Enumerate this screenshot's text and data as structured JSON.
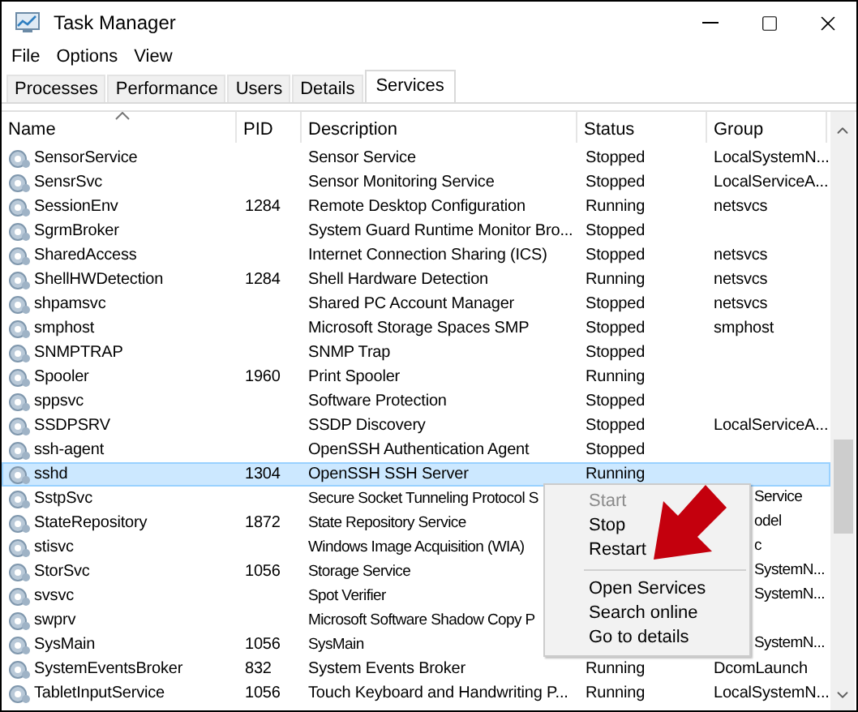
{
  "window": {
    "title": "Task Manager"
  },
  "menu": [
    "File",
    "Options",
    "View"
  ],
  "tabs": [
    {
      "label": "Processes",
      "selected": false
    },
    {
      "label": "Performance",
      "selected": false
    },
    {
      "label": "Users",
      "selected": false
    },
    {
      "label": "Details",
      "selected": false
    },
    {
      "label": "Services",
      "selected": true
    }
  ],
  "table": {
    "columns": [
      "Name",
      "PID",
      "Description",
      "Status",
      "Group"
    ],
    "rows": [
      {
        "name": "SensorService",
        "pid": "",
        "description": "Sensor Service",
        "status": "Stopped",
        "group": "LocalSystemN...",
        "selected": false,
        "covered": false
      },
      {
        "name": "SensrSvc",
        "pid": "",
        "description": "Sensor Monitoring Service",
        "status": "Stopped",
        "group": "LocalServiceA...",
        "selected": false,
        "covered": false
      },
      {
        "name": "SessionEnv",
        "pid": "1284",
        "description": "Remote Desktop Configuration",
        "status": "Running",
        "group": "netsvcs",
        "selected": false,
        "covered": false
      },
      {
        "name": "SgrmBroker",
        "pid": "",
        "description": "System Guard Runtime Monitor Bro...",
        "status": "Stopped",
        "group": "",
        "selected": false,
        "covered": false
      },
      {
        "name": "SharedAccess",
        "pid": "",
        "description": "Internet Connection Sharing (ICS)",
        "status": "Stopped",
        "group": "netsvcs",
        "selected": false,
        "covered": false
      },
      {
        "name": "ShellHWDetection",
        "pid": "1284",
        "description": "Shell Hardware Detection",
        "status": "Running",
        "group": "netsvcs",
        "selected": false,
        "covered": false
      },
      {
        "name": "shpamsvc",
        "pid": "",
        "description": "Shared PC Account Manager",
        "status": "Stopped",
        "group": "netsvcs",
        "selected": false,
        "covered": false
      },
      {
        "name": "smphost",
        "pid": "",
        "description": "Microsoft Storage Spaces SMP",
        "status": "Stopped",
        "group": "smphost",
        "selected": false,
        "covered": false
      },
      {
        "name": "SNMPTRAP",
        "pid": "",
        "description": "SNMP Trap",
        "status": "Stopped",
        "group": "",
        "selected": false,
        "covered": false
      },
      {
        "name": "Spooler",
        "pid": "1960",
        "description": "Print Spooler",
        "status": "Running",
        "group": "",
        "selected": false,
        "covered": false
      },
      {
        "name": "sppsvc",
        "pid": "",
        "description": "Software Protection",
        "status": "Stopped",
        "group": "",
        "selected": false,
        "covered": false
      },
      {
        "name": "SSDPSRV",
        "pid": "",
        "description": "SSDP Discovery",
        "status": "Stopped",
        "group": "LocalServiceA...",
        "selected": false,
        "covered": false
      },
      {
        "name": "ssh-agent",
        "pid": "",
        "description": "OpenSSH Authentication Agent",
        "status": "Stopped",
        "group": "",
        "selected": false,
        "covered": false
      },
      {
        "name": "sshd",
        "pid": "1304",
        "description": "OpenSSH SSH Server",
        "status": "Running",
        "group": "",
        "selected": true,
        "covered": false
      },
      {
        "name": "SstpSvc",
        "pid": "",
        "description": "Secure Socket Tunneling Protocol S",
        "status": "",
        "group": "Service",
        "selected": false,
        "covered": true
      },
      {
        "name": "StateRepository",
        "pid": "1872",
        "description": "State Repository Service",
        "status": "",
        "group": "odel",
        "selected": false,
        "covered": true
      },
      {
        "name": "stisvc",
        "pid": "",
        "description": "Windows Image Acquisition (WIA)",
        "status": "",
        "group": "c",
        "selected": false,
        "covered": true
      },
      {
        "name": "StorSvc",
        "pid": "1056",
        "description": "Storage Service",
        "status": "",
        "group": "SystemN...",
        "selected": false,
        "covered": true
      },
      {
        "name": "svsvc",
        "pid": "",
        "description": "Spot Verifier",
        "status": "",
        "group": "SystemN...",
        "selected": false,
        "covered": true
      },
      {
        "name": "swprv",
        "pid": "",
        "description": "Microsoft Software Shadow Copy P",
        "status": "",
        "group": "",
        "selected": false,
        "covered": true
      },
      {
        "name": "SysMain",
        "pid": "1056",
        "description": "SysMain",
        "status": "",
        "group": "SystemN...",
        "selected": false,
        "covered": true
      },
      {
        "name": "SystemEventsBroker",
        "pid": "832",
        "description": "System Events Broker",
        "status": "Running",
        "group": "DcomLaunch",
        "selected": false,
        "covered": false
      },
      {
        "name": "TabletInputService",
        "pid": "1056",
        "description": "Touch Keyboard and Handwriting P...",
        "status": "Running",
        "group": "LocalSystemN...",
        "selected": false,
        "covered": false
      }
    ]
  },
  "context_menu": {
    "items": [
      {
        "kind": "item",
        "label": "Start",
        "disabled": true
      },
      {
        "kind": "item",
        "label": "Stop",
        "disabled": false
      },
      {
        "kind": "item",
        "label": "Restart",
        "disabled": false
      },
      {
        "kind": "separator"
      },
      {
        "kind": "item",
        "label": "Open Services",
        "disabled": false
      },
      {
        "kind": "item",
        "label": "Search online",
        "disabled": false
      },
      {
        "kind": "item",
        "label": "Go to details",
        "disabled": false
      }
    ]
  }
}
